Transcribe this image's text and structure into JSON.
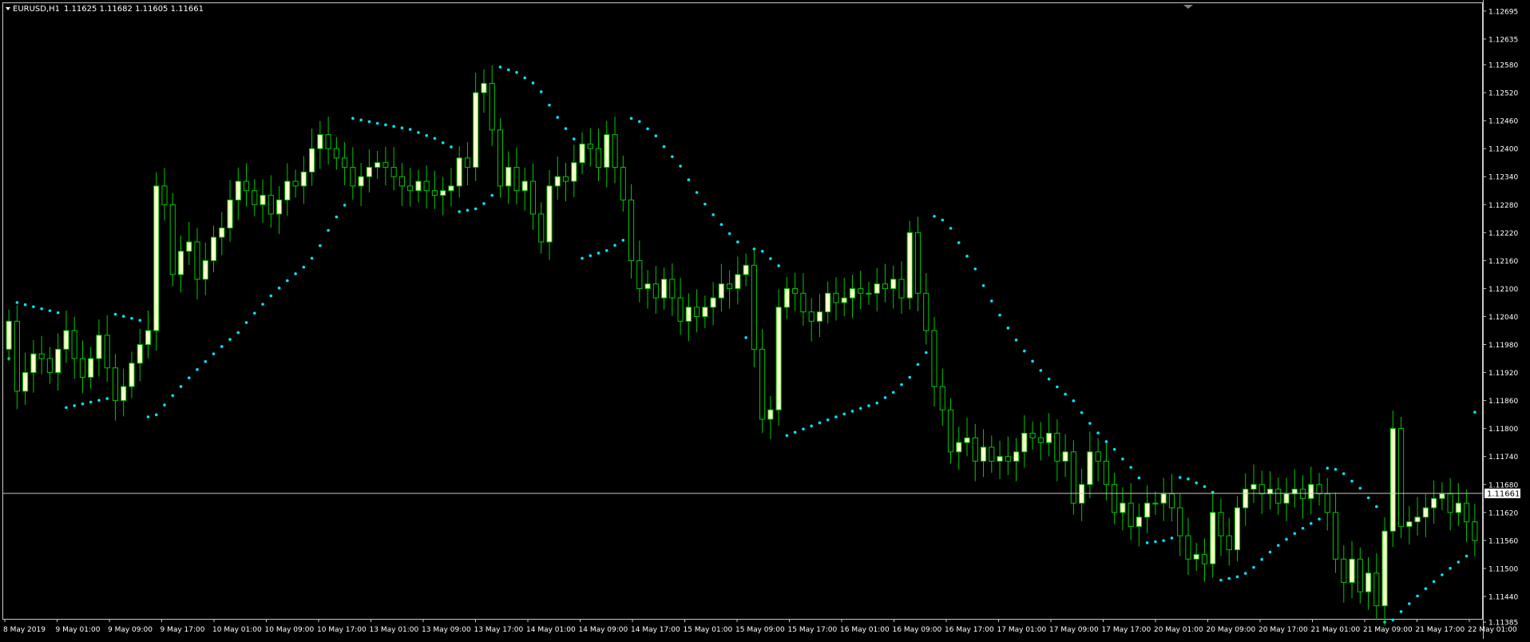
{
  "header": {
    "symbol": "EURUSD,H1",
    "ohlc": "1.11625 1.11682 1.11605 1.11661"
  },
  "current_price_label": "1.11661",
  "colors": {
    "background": "#000000",
    "frame": "#c8c8c8",
    "bull_body": "#ffffcc",
    "bear_body": "#000000",
    "wick": "#00c800",
    "sar": "#00e5ff",
    "bid_line": "#c8c8c8",
    "text": "#ffffff"
  },
  "chart_data": {
    "type": "candlestick",
    "symbol": "EURUSD",
    "timeframe": "H1",
    "indicators": [
      "Parabolic SAR"
    ],
    "grid": false,
    "ylim": [
      1.1138,
      1.12705
    ],
    "y_ticks": [
      "1.12695",
      "1.12635",
      "1.12580",
      "1.12520",
      "1.12460",
      "1.12400",
      "1.12340",
      "1.12280",
      "1.12220",
      "1.12160",
      "1.12100",
      "1.12040",
      "1.11980",
      "1.11920",
      "1.11860",
      "1.11800",
      "1.11740",
      "1.11680",
      "1.11620",
      "1.11560",
      "1.11500",
      "1.11440",
      "1.11385"
    ],
    "x_ticks": [
      "8 May 2019",
      "9 May 01:00",
      "9 May 09:00",
      "9 May 17:00",
      "10 May 01:00",
      "10 May 09:00",
      "10 May 17:00",
      "13 May 01:00",
      "13 May 09:00",
      "13 May 17:00",
      "14 May 01:00",
      "14 May 09:00",
      "14 May 17:00",
      "15 May 01:00",
      "15 May 09:00",
      "15 May 17:00",
      "16 May 01:00",
      "16 May 09:00",
      "16 May 17:00",
      "17 May 01:00",
      "17 May 09:00",
      "17 May 17:00",
      "20 May 01:00",
      "20 May 09:00",
      "20 May 17:00",
      "21 May 01:00",
      "21 May 09:00",
      "21 May 17:00",
      "22 May 01:00"
    ],
    "closes": [
      1.1203,
      1.1188,
      1.1192,
      1.1196,
      1.1195,
      1.1192,
      1.1197,
      1.1201,
      1.1195,
      1.1191,
      1.1195,
      1.12,
      1.1193,
      1.1186,
      1.1189,
      1.1194,
      1.1198,
      1.1201,
      1.1232,
      1.1228,
      1.1213,
      1.1218,
      1.122,
      1.1212,
      1.1216,
      1.1221,
      1.1223,
      1.1229,
      1.1233,
      1.1231,
      1.1228,
      1.123,
      1.1226,
      1.1229,
      1.1233,
      1.1232,
      1.1235,
      1.124,
      1.1243,
      1.124,
      1.1238,
      1.1236,
      1.1232,
      1.1234,
      1.1236,
      1.1237,
      1.1236,
      1.1234,
      1.1232,
      1.1231,
      1.1233,
      1.1231,
      1.123,
      1.1231,
      1.1232,
      1.1238,
      1.1236,
      1.1252,
      1.1254,
      1.1244,
      1.1232,
      1.1236,
      1.1231,
      1.1233,
      1.1226,
      1.122,
      1.1232,
      1.1234,
      1.1233,
      1.1237,
      1.1241,
      1.124,
      1.1236,
      1.1243,
      1.1236,
      1.1229,
      1.1216,
      1.121,
      1.1211,
      1.1208,
      1.1212,
      1.1208,
      1.1203,
      1.1206,
      1.1204,
      1.1206,
      1.1208,
      1.1211,
      1.121,
      1.1213,
      1.1215,
      1.1197,
      1.1182,
      1.1184,
      1.1206,
      1.121,
      1.1209,
      1.1205,
      1.1203,
      1.1205,
      1.1209,
      1.1207,
      1.1208,
      1.121,
      1.1209,
      1.1209,
      1.1211,
      1.121,
      1.1212,
      1.1208,
      1.1222,
      1.1209,
      1.1201,
      1.1189,
      1.1184,
      1.1175,
      1.1177,
      1.1178,
      1.1173,
      1.1176,
      1.1173,
      1.1174,
      1.1173,
      1.1175,
      1.1179,
      1.1178,
      1.1177,
      1.1179,
      1.1173,
      1.1175,
      1.1164,
      1.1168,
      1.1175,
      1.1173,
      1.1168,
      1.1162,
      1.1164,
      1.1159,
      1.1161,
      1.1164,
      1.1164,
      1.1166,
      1.1163,
      1.1157,
      1.1152,
      1.1153,
      1.1151,
      1.1162,
      1.1157,
      1.1154,
      1.1163,
      1.1167,
      1.1168,
      1.1166,
      1.1167,
      1.1164,
      1.1166,
      1.1167,
      1.1165,
      1.1168,
      1.1166,
      1.1162,
      1.1152,
      1.1147,
      1.1152,
      1.1145,
      1.1149,
      1.1142,
      1.1158,
      1.118,
      1.1159,
      1.116,
      1.1161,
      1.1163,
      1.1165,
      1.1166,
      1.1162,
      1.1164,
      1.116,
      1.1156
    ]
  }
}
